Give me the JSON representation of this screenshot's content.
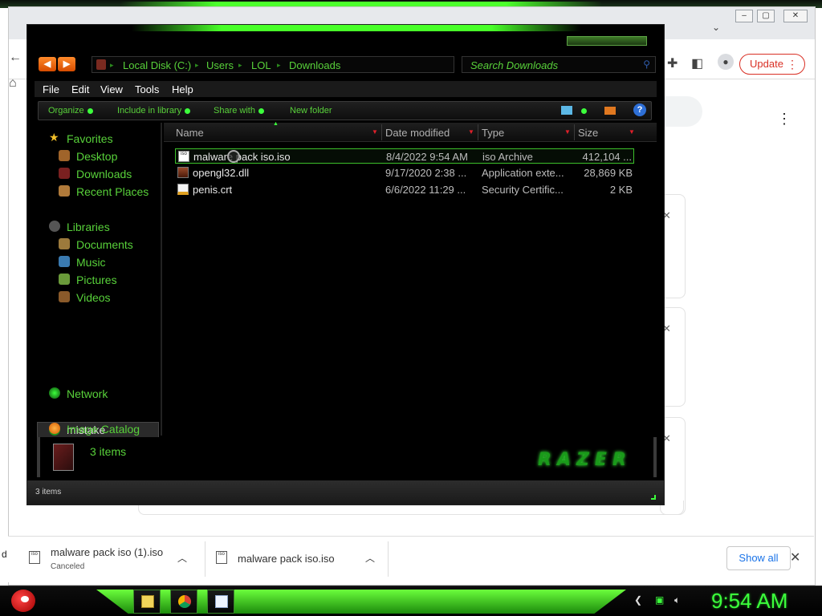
{
  "browser": {
    "update_label": "Update",
    "window_controls": [
      "–",
      "▢",
      "✕"
    ]
  },
  "downloads": {
    "items": [
      {
        "name": "malware pack iso (1).iso",
        "status": "Canceled",
        "icon": "iso-file-icon"
      },
      {
        "name": "malware pack iso.iso",
        "status": "",
        "icon": "iso-file-icon"
      }
    ],
    "show_all_label": "Show all",
    "left_fragment": "d"
  },
  "explorer": {
    "breadcrumbs": [
      "Local Disk (C:)",
      "Users",
      "LOL",
      "Downloads"
    ],
    "search_placeholder": "Search Downloads",
    "menu": [
      "File",
      "Edit",
      "View",
      "Tools",
      "Help"
    ],
    "commands": [
      "Organize",
      "Include in library",
      "Share with",
      "New folder"
    ],
    "nav": {
      "favorites_label": "Favorites",
      "favorites": [
        "Desktop",
        "Downloads",
        "Recent Places"
      ],
      "libraries_label": "Libraries",
      "libraries": [
        "Documents",
        "Music",
        "Pictures",
        "Videos"
      ],
      "mistake_label": "mistake",
      "network_label": "Network",
      "image_catalog_label": "Image Catalog"
    },
    "columns": [
      "Name",
      "Date modified",
      "Type",
      "Size"
    ],
    "files": [
      {
        "name": "malware pack iso.iso",
        "date": "8/4/2022 9:54 AM",
        "type": "iso Archive",
        "size": "412,104 ...",
        "icon": "iso-file-icon",
        "selected": true
      },
      {
        "name": "opengl32.dll",
        "date": "9/17/2020 2:38 ...",
        "type": "Application exte...",
        "size": "28,869 KB",
        "icon": "dll-file-icon",
        "selected": false
      },
      {
        "name": "penis.crt",
        "date": "6/6/2022 11:29 ...",
        "type": "Security Certific...",
        "size": "2 KB",
        "icon": "certificate-file-icon",
        "selected": false
      }
    ],
    "details_count": "3 items",
    "status_text": "3 items",
    "brand_logo": "RAZER"
  },
  "taskbar": {
    "clock": "9:54 AM",
    "accent": "#3cff3c"
  }
}
